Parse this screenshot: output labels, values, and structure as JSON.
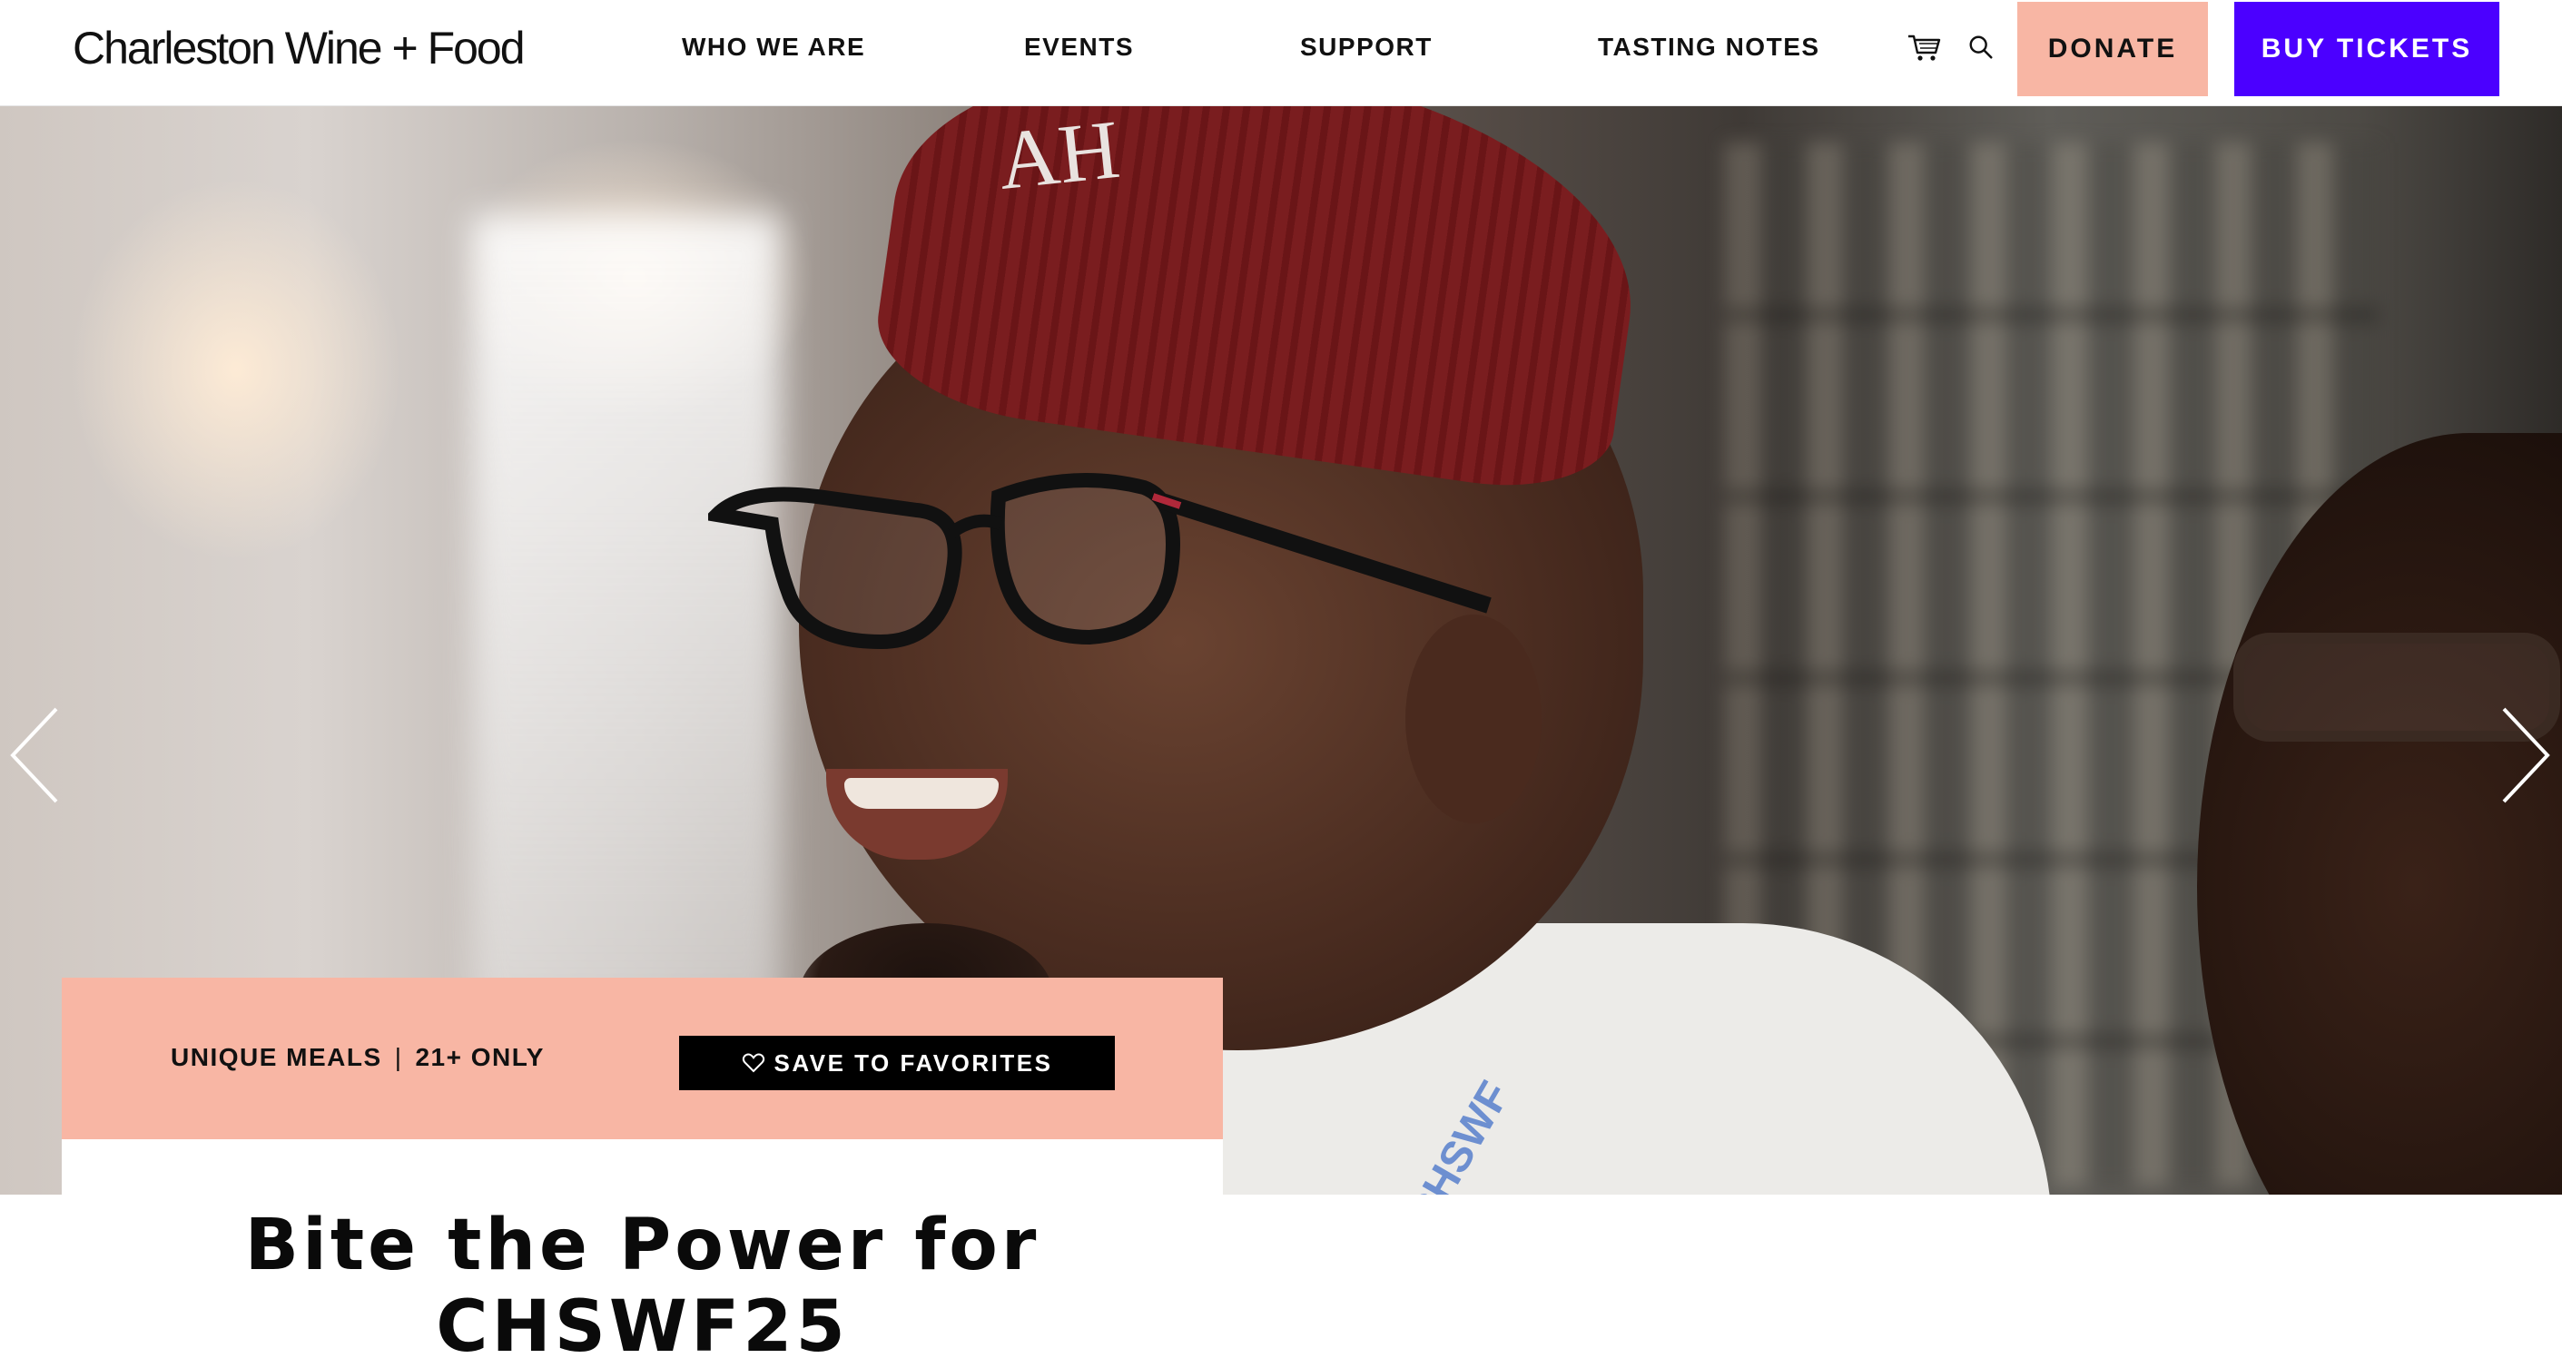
{
  "header": {
    "logo": "Charleston Wine + Food",
    "nav": [
      {
        "label": "WHO WE ARE"
      },
      {
        "label": "EVENTS"
      },
      {
        "label": "SUPPORT"
      },
      {
        "label": "TASTING NOTES"
      }
    ],
    "icons": {
      "cart": "cart-icon",
      "search": "search-icon"
    },
    "donate_label": "DONATE",
    "tickets_label": "BUY TICKETS"
  },
  "colors": {
    "donate_bg": "#f8b6a4",
    "tickets_bg": "#4b00ff",
    "card_bar_bg": "#f8b6a4",
    "favorite_bg": "#000000"
  },
  "hero": {
    "hat_text": "AH",
    "lanyard_text": "CHSWF",
    "prev_icon": "chevron-left-icon",
    "next_icon": "chevron-right-icon"
  },
  "event": {
    "tag_1": "UNIQUE MEALS",
    "tag_sep": "|",
    "tag_2": "21+ ONLY",
    "favorite_icon": "heart-icon",
    "favorite_label": "SAVE TO FAVORITES",
    "title_line_1": "Bite the Power for",
    "title_line_2": "CHSWF25"
  }
}
